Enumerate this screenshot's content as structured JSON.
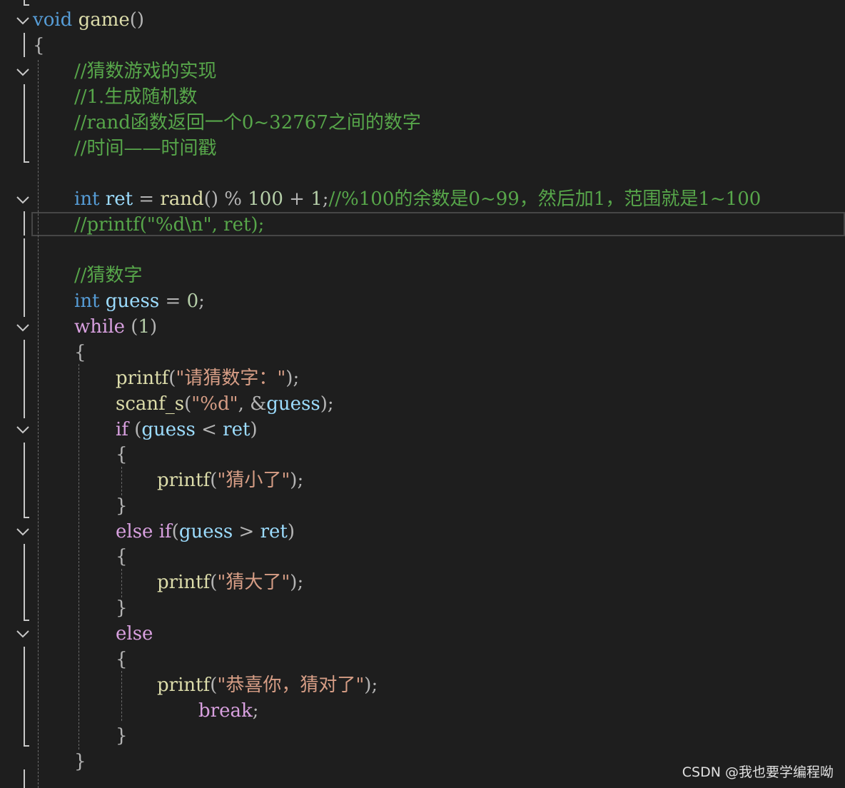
{
  "editor": {
    "lines": [
      {
        "tokens": [
          {
            "t": "void",
            "c": "kw"
          },
          {
            "t": " "
          },
          {
            "t": "game",
            "c": "fn"
          },
          {
            "t": "()",
            "c": "pun"
          }
        ]
      },
      {
        "tokens": [
          {
            "t": "{",
            "c": "pun"
          }
        ]
      },
      {
        "tokens": []
      },
      {
        "tokens": [
          {
            "t": "//猜数游戏的实现",
            "c": "cm"
          }
        ]
      },
      {
        "tokens": [
          {
            "t": "//1.生成随机数",
            "c": "cm"
          }
        ]
      },
      {
        "tokens": [
          {
            "t": "//rand函数返回一个0~32767之间的数字",
            "c": "cm"
          }
        ]
      },
      {
        "tokens": [
          {
            "t": "//时间——时间戳",
            "c": "cm"
          }
        ]
      },
      {
        "tokens": []
      },
      {
        "tokens": [
          {
            "t": "int",
            "c": "kw"
          },
          {
            "t": " "
          },
          {
            "t": "ret",
            "c": "var"
          },
          {
            "t": " = ",
            "c": "pun"
          },
          {
            "t": "rand",
            "c": "fn"
          },
          {
            "t": "() % ",
            "c": "pun"
          },
          {
            "t": "100",
            "c": "num"
          },
          {
            "t": " + ",
            "c": "pun"
          },
          {
            "t": "1",
            "c": "num"
          },
          {
            "t": ";",
            "c": "pun"
          },
          {
            "t": "//%100的余数是0~99，然后加1，范围就是1~100",
            "c": "cm"
          }
        ]
      },
      {
        "tokens": [
          {
            "t": "//printf(\"%d\\n\", ret);",
            "c": "cm"
          }
        ]
      },
      {
        "tokens": []
      },
      {
        "tokens": [
          {
            "t": "//猜数字",
            "c": "cm"
          }
        ]
      },
      {
        "tokens": [
          {
            "t": "int",
            "c": "kw"
          },
          {
            "t": " "
          },
          {
            "t": "guess",
            "c": "var"
          },
          {
            "t": " = ",
            "c": "pun"
          },
          {
            "t": "0",
            "c": "num"
          },
          {
            "t": ";",
            "c": "pun"
          }
        ]
      },
      {
        "tokens": [
          {
            "t": "while",
            "c": "ctl"
          },
          {
            "t": " (",
            "c": "pun"
          },
          {
            "t": "1",
            "c": "num"
          },
          {
            "t": ")",
            "c": "pun"
          }
        ]
      },
      {
        "tokens": [
          {
            "t": "{",
            "c": "pun"
          }
        ]
      },
      {
        "tokens": [
          {
            "t": "printf",
            "c": "fn"
          },
          {
            "t": "(",
            "c": "pun"
          },
          {
            "t": "\"请猜数字：\"",
            "c": "str"
          },
          {
            "t": ");",
            "c": "pun"
          }
        ]
      },
      {
        "tokens": [
          {
            "t": "scanf_s",
            "c": "fn"
          },
          {
            "t": "(",
            "c": "pun"
          },
          {
            "t": "\"%d\"",
            "c": "str"
          },
          {
            "t": ", &",
            "c": "pun"
          },
          {
            "t": "guess",
            "c": "var"
          },
          {
            "t": ");",
            "c": "pun"
          }
        ]
      },
      {
        "tokens": [
          {
            "t": "if",
            "c": "ctl"
          },
          {
            "t": " (",
            "c": "pun"
          },
          {
            "t": "guess",
            "c": "var"
          },
          {
            "t": " < ",
            "c": "pun"
          },
          {
            "t": "ret",
            "c": "var"
          },
          {
            "t": ")",
            "c": "pun"
          }
        ]
      },
      {
        "tokens": [
          {
            "t": "{",
            "c": "pun"
          }
        ]
      },
      {
        "tokens": [
          {
            "t": "printf",
            "c": "fn"
          },
          {
            "t": "(",
            "c": "pun"
          },
          {
            "t": "\"猜小了\"",
            "c": "str"
          },
          {
            "t": ");",
            "c": "pun"
          }
        ]
      },
      {
        "tokens": [
          {
            "t": "}",
            "c": "pun"
          }
        ]
      },
      {
        "tokens": [
          {
            "t": "else",
            "c": "ctl"
          },
          {
            "t": " "
          },
          {
            "t": "if",
            "c": "ctl"
          },
          {
            "t": "(",
            "c": "pun"
          },
          {
            "t": "guess",
            "c": "var"
          },
          {
            "t": " > ",
            "c": "pun"
          },
          {
            "t": "ret",
            "c": "var"
          },
          {
            "t": ")",
            "c": "pun"
          }
        ]
      },
      {
        "tokens": [
          {
            "t": "{",
            "c": "pun"
          }
        ]
      },
      {
        "tokens": [
          {
            "t": "printf",
            "c": "fn"
          },
          {
            "t": "(",
            "c": "pun"
          },
          {
            "t": "\"猜大了\"",
            "c": "str"
          },
          {
            "t": ");",
            "c": "pun"
          }
        ]
      },
      {
        "tokens": [
          {
            "t": "}",
            "c": "pun"
          }
        ]
      },
      {
        "tokens": [
          {
            "t": "else",
            "c": "ctl"
          }
        ]
      },
      {
        "tokens": [
          {
            "t": "{",
            "c": "pun"
          }
        ]
      },
      {
        "tokens": [
          {
            "t": "printf",
            "c": "fn"
          },
          {
            "t": "(",
            "c": "pun"
          },
          {
            "t": "\"恭喜你，猜对了\"",
            "c": "str"
          },
          {
            "t": ");",
            "c": "pun"
          }
        ]
      },
      {
        "tokens": [
          {
            "t": "break",
            "c": "ctl"
          },
          {
            "t": ";",
            "c": "pun"
          }
        ]
      },
      {
        "tokens": [
          {
            "t": "}",
            "c": "pun"
          }
        ]
      },
      {
        "tokens": [
          {
            "t": "}",
            "c": "pun"
          }
        ]
      }
    ]
  },
  "watermark": "CSDN @我也要学编程呦",
  "colors": {
    "background": "#1e1e1e",
    "keyword": "#569cd6",
    "control": "#d8a0df",
    "function": "#dcdcaa",
    "variable": "#9cdcfe",
    "number": "#b5cea8",
    "string": "#d69d85",
    "comment": "#57a64a"
  }
}
